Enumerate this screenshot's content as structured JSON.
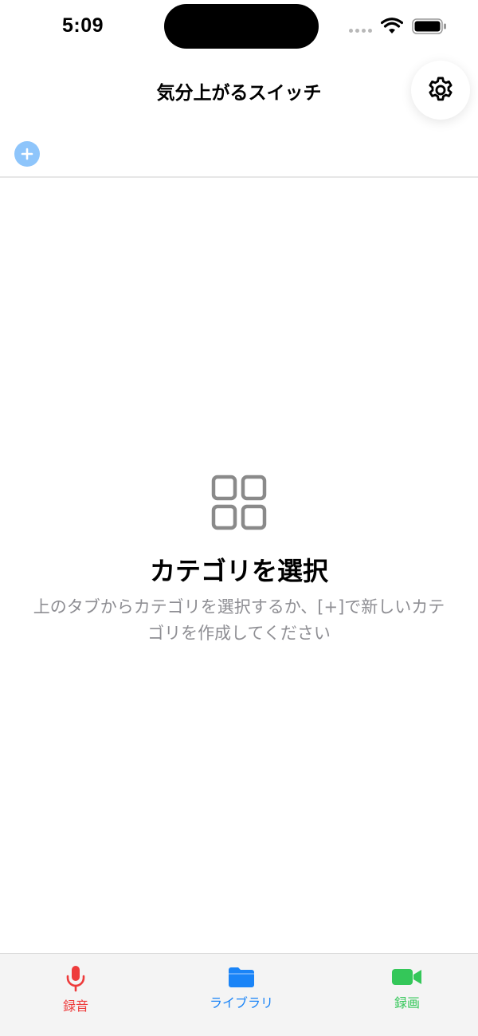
{
  "status_bar": {
    "time": "5:09"
  },
  "header": {
    "title": "気分上がるスイッチ",
    "settings_icon": "gear-icon"
  },
  "category_tabs": {
    "add_icon": "plus-circle-icon",
    "accent_color": "#8ec5fb"
  },
  "empty_state": {
    "icon": "grid-icon",
    "title": "カテゴリを選択",
    "message": "上のタブからカテゴリを選択するか、[+]で新しいカテゴリを作成してください"
  },
  "bottom_tabs": [
    {
      "label": "録音",
      "icon": "microphone-icon",
      "color": "#ee3b3b"
    },
    {
      "label": "ライブラリ",
      "icon": "folder-icon",
      "color": "#1a84f7"
    },
    {
      "label": "録画",
      "icon": "video-camera-icon",
      "color": "#34c759"
    }
  ]
}
